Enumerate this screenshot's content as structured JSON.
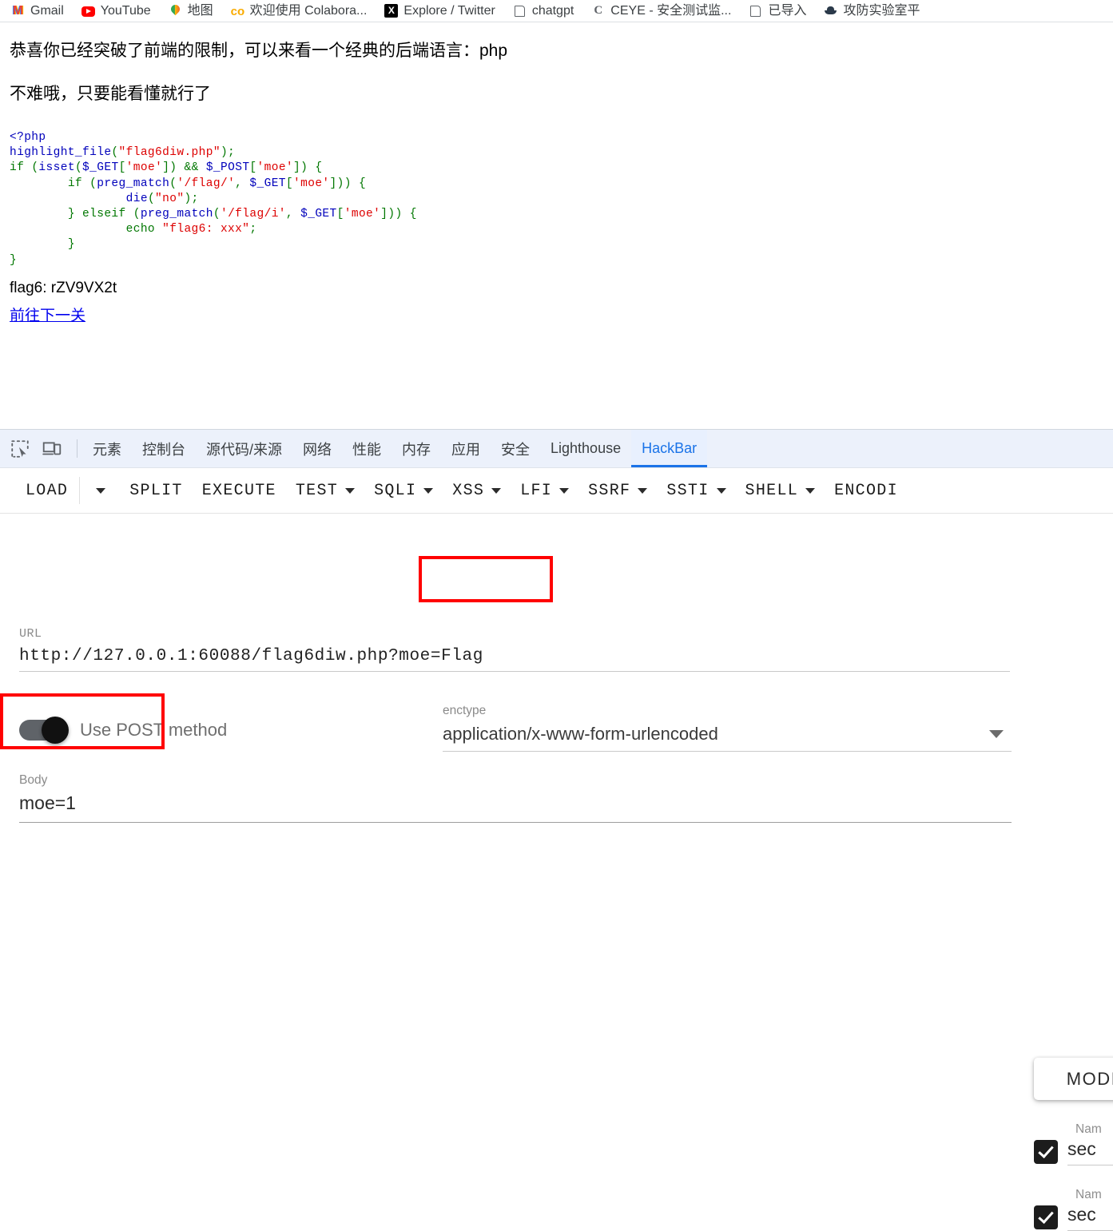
{
  "bookmarks": [
    {
      "label": "Gmail",
      "icon": "gmail-icon"
    },
    {
      "label": "YouTube",
      "icon": "youtube-icon"
    },
    {
      "label": "地图",
      "icon": "google-maps-icon"
    },
    {
      "label": "欢迎使用 Colabora...",
      "icon": "colab-icon"
    },
    {
      "label": "Explore / Twitter",
      "icon": "x-twitter-icon"
    },
    {
      "label": "chatgpt",
      "icon": "page-icon"
    },
    {
      "label": "CEYE - 安全测试监...",
      "icon": "ceye-icon"
    },
    {
      "label": "已导入",
      "icon": "page-icon"
    },
    {
      "label": "攻防实验室平",
      "icon": "lab-icon"
    }
  ],
  "page": {
    "paragraph1": "恭喜你已经突破了前端的限制，可以来看一个经典的后端语言：php",
    "paragraph2": "不难哦，只要能看懂就行了",
    "code_lines": [
      "<?php",
      "highlight_file(\"flag6diw.php\");",
      "if (isset($_GET['moe']) && $_POST['moe']) {",
      "        if (preg_match('/flag/', $_GET['moe'])) {",
      "                die(\"no\");",
      "        } elseif (preg_match('/flag/i', $_GET['moe'])) {",
      "                echo \"flag6: xxx\";",
      "        }",
      "}"
    ],
    "flag_text": "flag6: rZV9VX2t",
    "next_link": "前往下一关"
  },
  "devtools": {
    "icons": [
      {
        "name": "inspect-element-icon"
      },
      {
        "name": "device-toolbar-icon"
      }
    ],
    "tabs": [
      {
        "label": "元素",
        "active": false
      },
      {
        "label": "控制台",
        "active": false
      },
      {
        "label": "源代码/来源",
        "active": false
      },
      {
        "label": "网络",
        "active": false
      },
      {
        "label": "性能",
        "active": false
      },
      {
        "label": "内存",
        "active": false
      },
      {
        "label": "应用",
        "active": false
      },
      {
        "label": "安全",
        "active": false
      },
      {
        "label": "Lighthouse",
        "active": false
      },
      {
        "label": "HackBar",
        "active": true
      }
    ],
    "active_tab_color": "#1a73e8"
  },
  "hackbar": {
    "toolbar": [
      {
        "label": "LOAD",
        "caret": false
      },
      {
        "label": "",
        "caret": true
      },
      {
        "label": "SPLIT",
        "caret": false
      },
      {
        "label": "EXECUTE",
        "caret": false
      },
      {
        "label": "TEST",
        "caret": true
      },
      {
        "label": "SQLI",
        "caret": true
      },
      {
        "label": "XSS",
        "caret": true
      },
      {
        "label": "LFI",
        "caret": true
      },
      {
        "label": "SSRF",
        "caret": true
      },
      {
        "label": "SSTI",
        "caret": true
      },
      {
        "label": "SHELL",
        "caret": true
      },
      {
        "label": "ENCODI",
        "caret": false
      }
    ],
    "url": {
      "label": "URL",
      "value": "http://127.0.0.1:60088/flag6diw.php?moe=Flag"
    },
    "post_toggle": {
      "label": "Use POST method",
      "enabled": true
    },
    "enctype": {
      "label": "enctype",
      "value": "application/x-www-form-urlencoded"
    },
    "body": {
      "label": "Body",
      "value": "moe=1"
    },
    "right_panel": {
      "modify_label": "MODIF",
      "headers": [
        {
          "name_label": "Nam",
          "value": "sec",
          "checked": true
        },
        {
          "name_label": "Nam",
          "value": "sec",
          "checked": true
        }
      ]
    },
    "annotations": {
      "highlight_color": "#ff0000"
    }
  }
}
